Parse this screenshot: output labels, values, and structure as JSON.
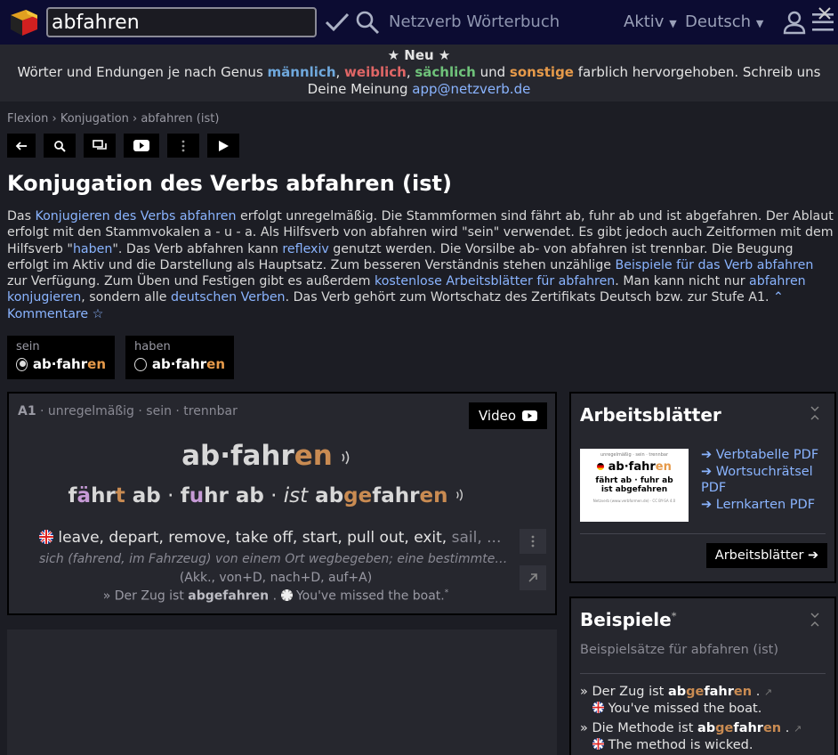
{
  "header": {
    "search_value": "abfahren",
    "site_title": "Netzverb Wörterbuch",
    "nav_aktiv": "Aktiv",
    "nav_lang": "Deutsch"
  },
  "notice": {
    "neu": "★ Neu ★",
    "t1": "Wörter und Endungen je nach Genus ",
    "m": "männlich",
    "sep1": ", ",
    "f": "weiblich",
    "sep2": ", ",
    "n": "sächlich",
    "t2": " und ",
    "s": "sonstige",
    "t3": " farblich hervorgehoben. Schreib uns",
    "t4": "Deine Meinung ",
    "email": "app@netzverb.de"
  },
  "breadcrumb": [
    "Flexion",
    "Konjugation",
    "abfahren (ist)"
  ],
  "page": {
    "title": "Konjugation des Verbs abfahren (ist)",
    "intro": [
      {
        "t": "Das "
      },
      {
        "a": "Konjugieren des Verbs abfahren"
      },
      {
        "t": " erfolgt unregelmäßig. Die Stammformen sind fährt ab, fuhr ab und ist abgefahren. Der Ab­laut erfolgt mit den Stammvokalen a - u - a. Als Hilfsverb von abfahren wird \"sein\" verwendet. Es gibt jedoch auch Zeitformen mit dem Hilfsverb \""
      },
      {
        "a": "haben"
      },
      {
        "t": "\". Das Verb abfahren kann "
      },
      {
        "a": "reflexiv"
      },
      {
        "t": " genutzt werden. Die Vorsilbe ab- von abfahren ist trennbar. Die Beugung erfolgt im Aktiv und die Darstellung als Hauptsatz. Zum besseren Verständnis stehen unzählige "
      },
      {
        "a": "Beispiele für das Verb abfahren"
      },
      {
        "t": " zur Verfügung. Zum Üben und Festigen gibt es außerdem "
      },
      {
        "a": "kostenlose Arbeitsblätter für abfahren"
      },
      {
        "t": ". Man kann nicht nur "
      },
      {
        "a": "abfahren konjugieren"
      },
      {
        "t": ", sondern alle "
      },
      {
        "a": "deutschen Verben"
      },
      {
        "t": ". Das Verb gehört zum Wortschatz des Zertifikats Deutsch bzw. zur Stufe A1. "
      },
      {
        "a": "⌃ Kommentare ☆"
      }
    ]
  },
  "aux": [
    {
      "label": "sein",
      "stem": "ab·fahr",
      "ending": "en",
      "selected": true
    },
    {
      "label": "haben",
      "stem": "ab·fahr",
      "ending": "en",
      "selected": false
    }
  ],
  "verb": {
    "level": "A1",
    "meta": " · unregelmäßig · sein · trennbar",
    "video_label": "Video",
    "inf_stem": "ab·fahr",
    "inf_end": "en",
    "f1a": "f",
    "f1b": "ä",
    "f1c": "hr",
    "f1d": "t",
    "f1e": " ab",
    "sep": " · ",
    "f2a": "f",
    "f2b": "u",
    "f2c": "hr ab",
    "f3ist": "ist",
    "f3a": " ab",
    "f3b": "ge",
    "f3c": "fahr",
    "f3d": "en",
    "translation": "leave, depart, remove, take off, start, pull out, exit, ",
    "translation_dim": "sail, ...",
    "description": "sich (fahrend, im Fahrzeug) von einem Ort wegbegeben; eine bestimmte Strecke befahren",
    "args": "(Akk., von+D, nach+D, auf+A)",
    "ex_pre": "» Der Zug ist ",
    "ex_bold": "abgefahren",
    "ex_mid": " . ",
    "ex_en": "You've missed the boat.",
    "ex_star": "*"
  },
  "worksheets": {
    "title": "Arbeitsblätter",
    "thumb_meta": "unregelmäßig · sein · trennbar",
    "thumb_stem": "ab·fahr",
    "thumb_end": "en",
    "thumb_forms": "fährt ab · fuhr ab",
    "thumb_forms2": "ist abgefahren",
    "thumb_footer": "Netzverb (www.verbformen.de) · CC BY-SA 4.0",
    "links": [
      "➔ Verbtabelle PDF",
      "➔ Wortsuchrätsel PDF",
      "➔ Lernkarten PDF"
    ],
    "button": "Arbeitsblätter ➔"
  },
  "examples": {
    "title": "Beispiele",
    "title_star": "*",
    "subtitle": "Beispielsätze für abfahren (ist)",
    "items": [
      {
        "pre": "» Der Zug ist ",
        "b1": "ab",
        "b2": "ge",
        "b3": "fahr",
        "b4": "en",
        "post": " .",
        "en": "You've missed the boat."
      },
      {
        "pre": "» Die Methode ist ",
        "b1": "ab",
        "b2": "ge",
        "b3": "fahr",
        "b4": "en",
        "post": " .",
        "en": "The method is wicked."
      }
    ]
  },
  "colors": {
    "masculine": "#6fa8dc",
    "feminine": "#e06666",
    "neuter": "#6fc27a",
    "other": "#e69a4a",
    "ending": "#c98b52"
  }
}
